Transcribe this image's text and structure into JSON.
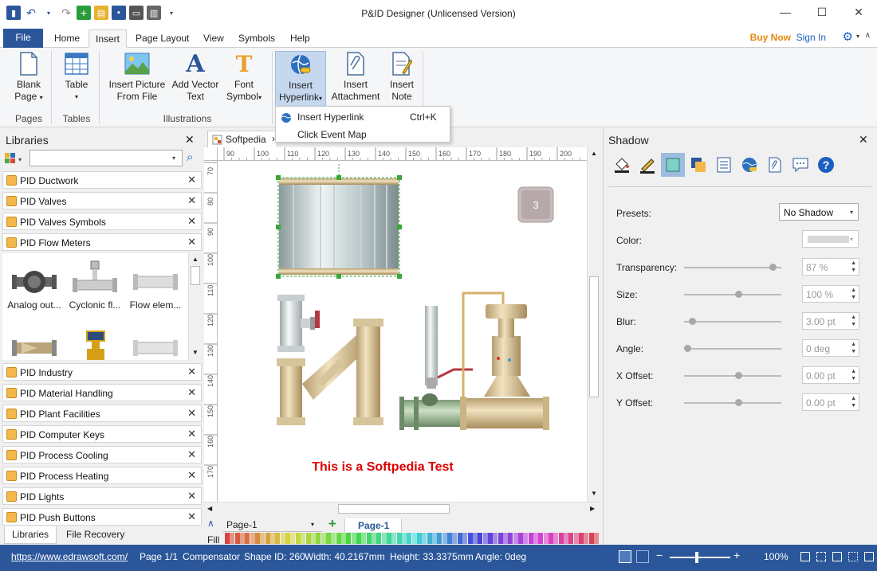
{
  "window": {
    "title": "P&ID Designer (Unlicensed Version)",
    "minimize": "—",
    "maximize": "☐",
    "close": "✕"
  },
  "tabs": [
    "File",
    "Home",
    "Insert",
    "Page Layout",
    "View",
    "Symbols",
    "Help"
  ],
  "active_tab": "Insert",
  "account": {
    "buy_now": "Buy Now",
    "sign_in": "Sign In"
  },
  "ribbon": {
    "blank_page": [
      "Blank",
      "Page"
    ],
    "table": "Table",
    "insert_picture": [
      "Insert Picture",
      "From File"
    ],
    "add_vector_text": [
      "Add Vector",
      "Text"
    ],
    "font_symbol": [
      "Font",
      "Symbol"
    ],
    "insert_hyperlink": [
      "Insert",
      "Hyperlink"
    ],
    "insert_attachment": [
      "Insert",
      "Attachment"
    ],
    "insert_note": [
      "Insert",
      "Note"
    ],
    "groups": [
      "Pages",
      "Tables",
      "Illustrations"
    ]
  },
  "menu": {
    "items": [
      {
        "label": "Insert Hyperlink",
        "shortcut": "Ctrl+K"
      },
      {
        "label": "Click Event Map",
        "shortcut": ""
      }
    ]
  },
  "libraries": {
    "title": "Libraries",
    "top": [
      "PID Ductwork",
      "PID Valves",
      "PID Valves Symbols",
      "PID Flow Meters"
    ],
    "shapes": [
      "Analog out...",
      "Cyclonic fl...",
      "Flow elem..."
    ],
    "bottom": [
      "PID Industry",
      "PID Material Handling",
      "PID Plant Facilities",
      "PID Computer Keys",
      "PID Process Cooling",
      "PID Process Heating",
      "PID Lights",
      "PID Push Buttons"
    ],
    "tabs": [
      "Libraries",
      "File Recovery"
    ]
  },
  "document": {
    "tab": "Softpedia",
    "ruler_h": [
      "90",
      "100",
      "110",
      "120",
      "130",
      "140",
      "150",
      "160",
      "170",
      "180",
      "190",
      "200"
    ],
    "ruler_v": [
      "70",
      "80",
      "90",
      "100",
      "110",
      "120",
      "130",
      "140",
      "150",
      "160",
      "170"
    ],
    "badge": "3",
    "caption": "This is a Softpedia Test",
    "page_select": "Page-1",
    "page_tab": "Page-1",
    "fill_label": "Fill"
  },
  "shadow": {
    "title": "Shadow",
    "presets_label": "Presets:",
    "presets_value": "No Shadow",
    "color_label": "Color:",
    "rows": [
      {
        "label": "Transparency:",
        "value": "87 %",
        "level": 0.95
      },
      {
        "label": "Size:",
        "value": "100 %",
        "level": 0.57
      },
      {
        "label": "Blur:",
        "value": "3.00 pt",
        "level": 0.05
      },
      {
        "label": "Angle:",
        "value": "0 deg",
        "level": 0.0
      },
      {
        "label": "X Offset:",
        "value": "0.00 pt",
        "level": 0.57
      },
      {
        "label": "Y Offset:",
        "value": "0.00 pt",
        "level": 0.57
      }
    ]
  },
  "status": {
    "url": "https://www.edrawsoft.com/",
    "page": "Page 1/1",
    "shape": "Compensator",
    "shape_id": "Shape ID: 260",
    "width": "Width: 40.2167mm",
    "height": "Height: 33.3375mm",
    "angle": "Angle: 0deg",
    "zoom": "100%"
  },
  "colors": {
    "accent": "#2b579a",
    "buy_now": "#e8860c",
    "caption": "#dd0000",
    "selection": "#c5d8ee"
  }
}
